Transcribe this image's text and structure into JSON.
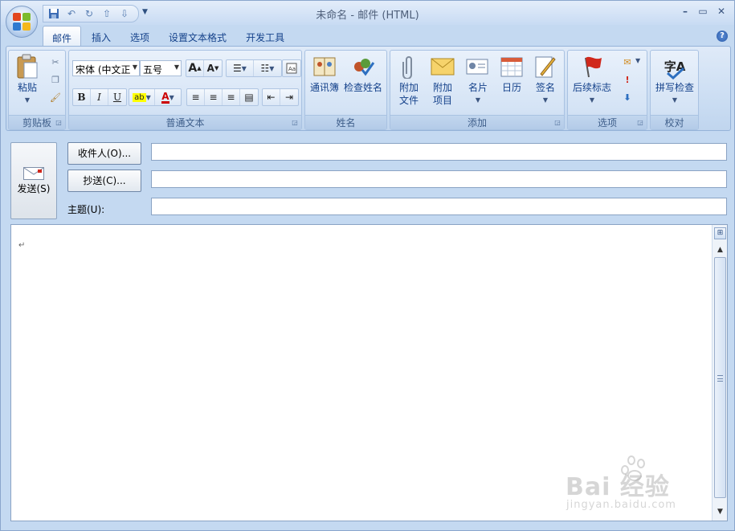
{
  "window": {
    "title": "未命名 - 邮件 (HTML)",
    "minimize": "–",
    "maximize": "▭",
    "close": "✕"
  },
  "qat": {
    "save_icon": "save-icon",
    "undo_icon": "undo-icon",
    "redo_icon": "redo-icon",
    "prev_icon": "up-arrow-icon",
    "next_icon": "down-arrow-icon"
  },
  "tabs": [
    {
      "label": "邮件",
      "active": true
    },
    {
      "label": "插入"
    },
    {
      "label": "选项"
    },
    {
      "label": "设置文本格式"
    },
    {
      "label": "开发工具"
    }
  ],
  "ribbon": {
    "clipboard": {
      "label": "剪贴板",
      "paste": "粘贴"
    },
    "basic_text": {
      "label": "普通文本",
      "font": "宋体 (中文正",
      "size": "五号",
      "bold": "B",
      "italic": "I",
      "underline": "U"
    },
    "names": {
      "label": "姓名",
      "address_book": "通讯簿",
      "check_names": "检查姓名"
    },
    "include": {
      "label": "添加",
      "attach_file_1": "附加",
      "attach_file_2": "文件",
      "attach_item_1": "附加",
      "attach_item_2": "项目",
      "business_card": "名片",
      "calendar": "日历",
      "signature": "签名"
    },
    "options": {
      "label": "选项",
      "follow_up": "后续标志"
    },
    "proofing": {
      "label": "校对",
      "spelling": "拼写检查",
      "spell_glyph": "字A"
    }
  },
  "compose": {
    "send": "发送(S)",
    "to_button": "收件人(O)...",
    "cc_button": "抄送(C)...",
    "subject_label": "主题(U):",
    "to_value": "",
    "cc_value": "",
    "subject_value": "",
    "para_mark": "↵"
  },
  "watermark": {
    "logo": "Bai 经验",
    "url": "jingyan.baidu.com"
  }
}
